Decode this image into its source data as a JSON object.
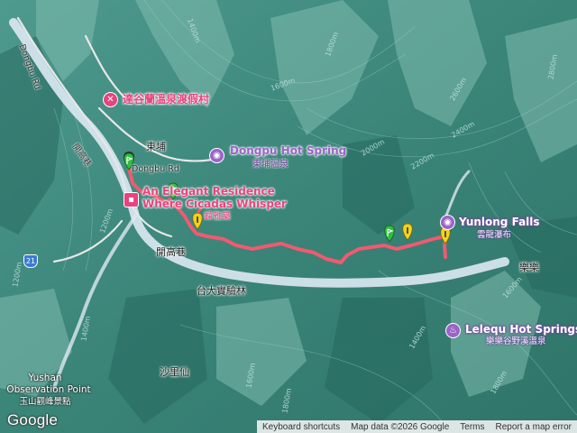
{
  "map": {
    "colors": {
      "terrain": "#3d8a7f",
      "ridge": "#88c4b6",
      "river": "#dde9f3",
      "route": "#f05a70"
    }
  },
  "pois": {
    "resort": "達谷蘭溫泉渡假村",
    "dongpu_hot_spring": {
      "name": "Dongpu Hot Spring",
      "sub": "東埔溫泉"
    },
    "residence": {
      "line1": "An Elegant Residence",
      "line2": "Where Cicadas Whisper",
      "sub": "蟬雅築"
    },
    "yunlong_falls": {
      "name": "Yunlong Falls",
      "sub": "雲龍瀑布"
    },
    "lelequ": {
      "name": "Lelequ Hot Springs",
      "sub": "樂樂谷野溪溫泉"
    },
    "yushan_obs": {
      "line1": "Yushan",
      "line2": "Observation Point",
      "sub": "玉山觀峰景點"
    }
  },
  "places": {
    "dongpu": "東埔",
    "kaigao_lane": "開高巷",
    "kaigao_lane_vertical": "開高巷",
    "taida_forest": "台大實驗林",
    "shalixian": "沙里仙",
    "lele": "樂樂"
  },
  "roads": {
    "dongbu_rd_top": "Dongbu Rd",
    "dongbu_rd_mid": "Dongbu Rd",
    "road_1200": "1200m",
    "route_number": "21"
  },
  "contours": {
    "c1": "1400m",
    "c2": "1600m",
    "c3": "1800m",
    "c4": "2000m",
    "c5": "2200m",
    "c6": "2400m",
    "c7": "2600m",
    "c8": "2800m",
    "c9": "1600m",
    "c10": "1400m",
    "c11": "1800m",
    "c12": "1200m",
    "c13": "1400m",
    "c14": "1600m",
    "c15": "1800m"
  },
  "brand": "Google",
  "footer": {
    "shortcuts": "Keyboard shortcuts",
    "map_data": "Map data ©2026 Google",
    "terms": "Terms",
    "report": "Report a map error"
  }
}
